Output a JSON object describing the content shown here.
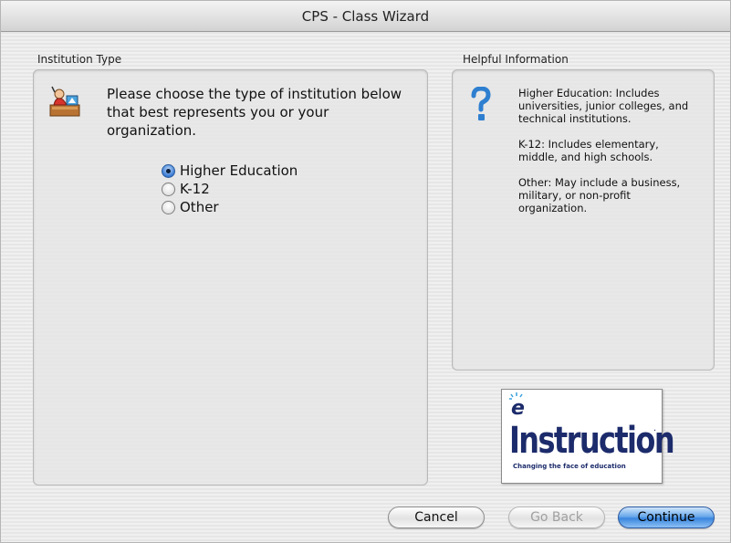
{
  "window": {
    "title": "CPS - Class Wizard"
  },
  "institution": {
    "label": "Institution Type",
    "prompt": "Please choose the type of institution below that best represents you or your organization.",
    "icon": "teacher-at-desk-icon",
    "options": [
      {
        "label": "Higher Education",
        "selected": true
      },
      {
        "label": "K-12",
        "selected": false
      },
      {
        "label": "Other",
        "selected": false
      }
    ]
  },
  "help": {
    "label": "Helpful Information",
    "icon": "question-mark-icon",
    "paragraphs": [
      "Higher Education: Includes universities, junior colleges, and technical institutions.",
      "K-12: Includes elementary, middle, and high schools.",
      "Other: May include a business, military, or non-profit organization."
    ]
  },
  "logo": {
    "letter": "e",
    "word": "Instruction",
    "mark": "·",
    "tagline": "Changing the face of education"
  },
  "buttons": {
    "cancel": "Cancel",
    "go_back": "Go Back",
    "continue": "Continue"
  },
  "colors": {
    "accent": "#3a86de",
    "logo_blue": "#1c2b6b"
  }
}
